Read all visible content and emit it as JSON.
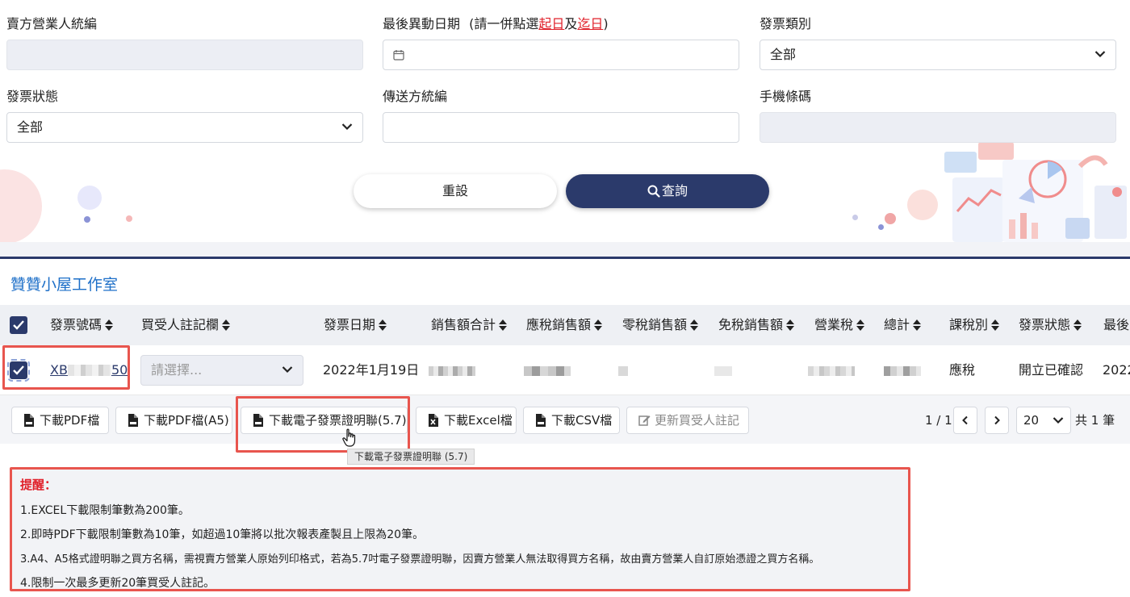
{
  "form": {
    "seller_id_label": "賣方營業人統編",
    "seller_id_value": "",
    "date_label": "最後異動日期",
    "date_hint_prefix": "(請一併點選",
    "date_hint_start": "起日",
    "date_hint_and": "及",
    "date_hint_end": "迄日",
    "date_hint_suffix": ")",
    "date_value": "",
    "invoice_type_label": "發票類別",
    "invoice_type_value": "全部",
    "invoice_status_label": "發票狀態",
    "invoice_status_value": "全部",
    "sender_id_label": "傳送方統編",
    "sender_id_value": "",
    "mobile_barcode_label": "手機條碼",
    "mobile_barcode_value": "",
    "reset_label": "重設",
    "search_label": "查詢"
  },
  "company_name": "贊贊小屋工作室",
  "table": {
    "columns": [
      "發票號碼",
      "買受人註記欄",
      "發票日期",
      "銷售額合計",
      "應稅銷售額",
      "零稅銷售額",
      "免稅銷售額",
      "營業稅",
      "總計",
      "課稅別",
      "發票狀態",
      "最後"
    ],
    "rows": [
      {
        "invoice_no_start": "XB",
        "invoice_no_end": "50",
        "buyer_note_placeholder": "請選擇...",
        "invoice_date": "2022年1月19日",
        "tax_type": "應稅",
        "status": "開立已確認",
        "last": "2022"
      }
    ]
  },
  "toolbar": {
    "pdf": "下載PDF檔",
    "pdf_a5": "下載PDF檔(A5)",
    "e_invoice": "下載電子發票證明聯(5.7)",
    "excel": "下載Excel檔",
    "csv": "下載CSV檔",
    "update_note": "更新買受人註記",
    "page": "1 / 1",
    "page_size": "20",
    "total": "共 1 筆",
    "tooltip": "下載電子發票證明聯 (5.7)"
  },
  "notes": {
    "title": "提醒：",
    "items": [
      "1.EXCEL下載限制筆數為200筆。",
      "2.即時PDF下載限制筆數為10筆，如超過10筆將以批次報表產製且上限為20筆。",
      "3.A4、A5格式證明聯之買方名稱，需視賣方營業人原始列印格式，若為5.7吋電子發票證明聯，因賣方營業人無法取得買方名稱，故由賣方營業人自訂原始憑證之買方名稱。",
      "4.限制一次最多更新20筆買受人註記。"
    ]
  },
  "colors": {
    "primary": "#2b3a6b",
    "link": "#1d6fc8",
    "alert": "#e0202a",
    "highlight": "#e8554e"
  }
}
